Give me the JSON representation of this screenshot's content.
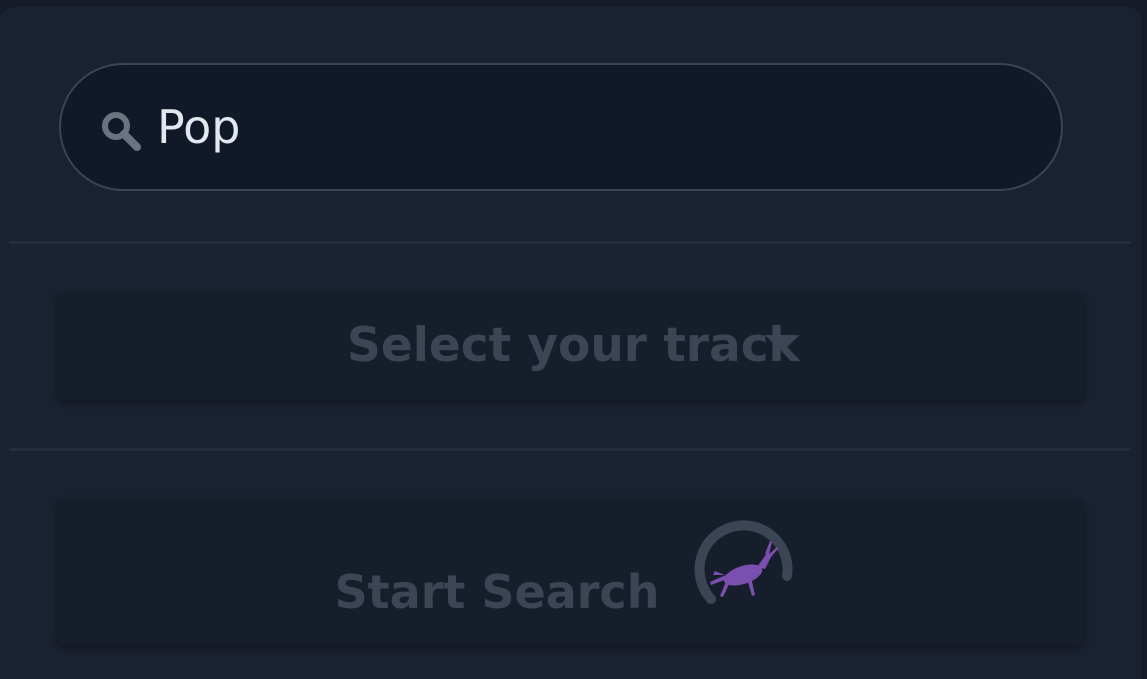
{
  "search": {
    "value": "Pop",
    "icon": "search-icon"
  },
  "track_selector": {
    "label": "Select your track",
    "icon": "caret-down-icon"
  },
  "start_search": {
    "label": "Start Search",
    "icon": "loading-spinner-icon"
  },
  "colors": {
    "background": "#1a2130",
    "input_background": "#111827",
    "input_border": "#3a4454",
    "muted_text": "#3c4554",
    "accent": "#7b4fb0"
  }
}
